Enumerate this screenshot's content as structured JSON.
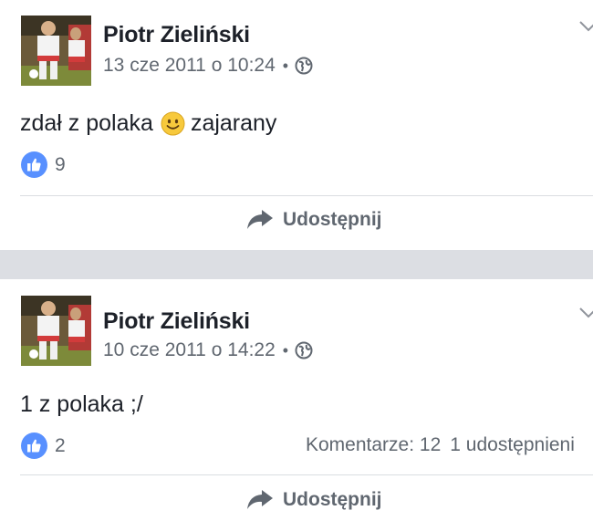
{
  "posts": [
    {
      "author": "Piotr Zieliński",
      "date": "13 cze 2011 o 10:24",
      "separator": "•",
      "text_before": "zdał z polaka",
      "emoji": "smile-emoji",
      "text_after": "zajarany",
      "likes": "9",
      "share_label": "Udostępnij"
    },
    {
      "author": "Piotr Zieliński",
      "date": "10 cze 2011 o 14:22",
      "separator": "•",
      "text_before": "1 z polaka ;/",
      "likes": "2",
      "comments": "Komentarze: 12",
      "shares": "1 udostępnieni",
      "share_label": "Udostępnij"
    }
  ],
  "colors": {
    "like_blue": "#5890ff",
    "meta_gray": "#606770",
    "separator_bg": "#dcdee3",
    "text_dark": "#1d2129"
  }
}
